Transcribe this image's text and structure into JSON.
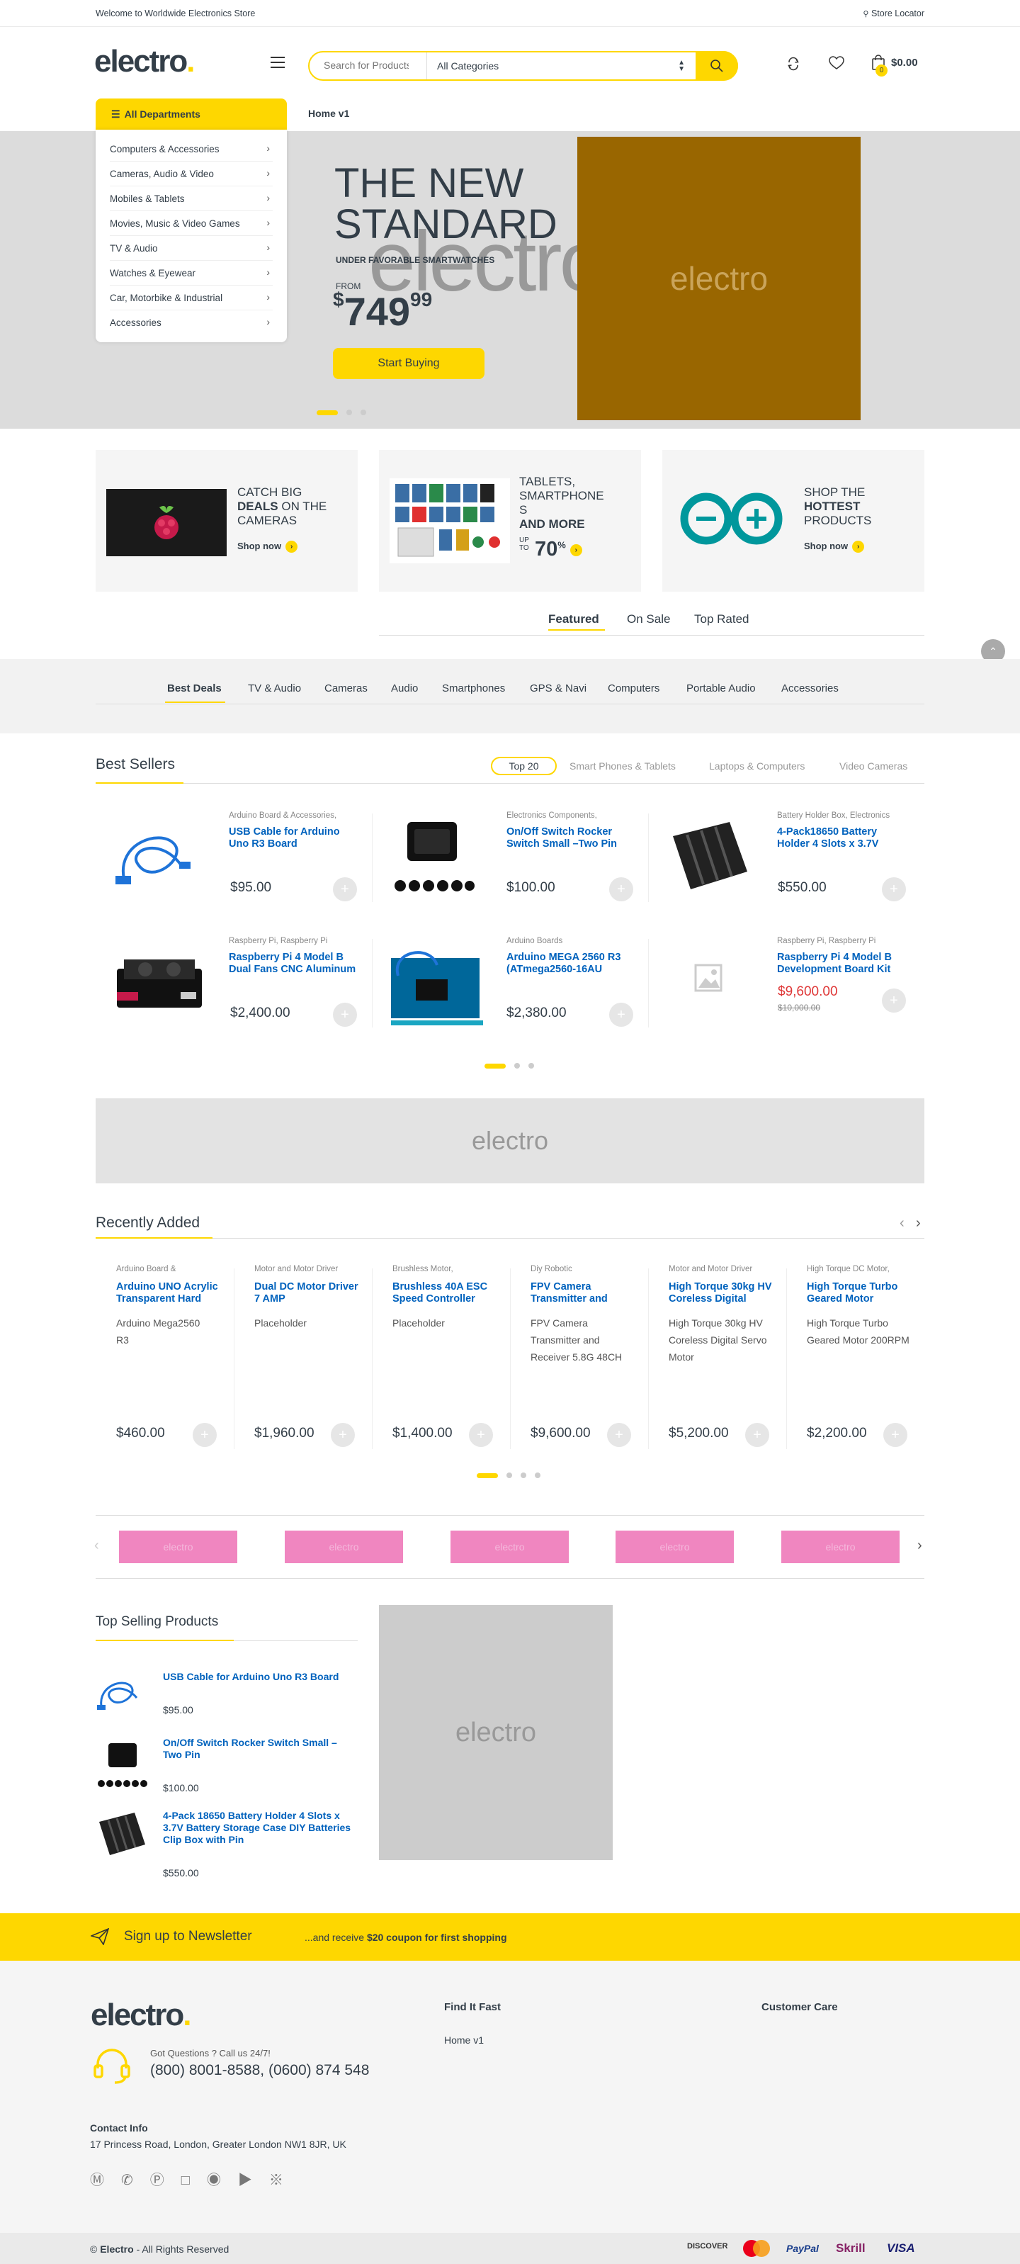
{
  "topbar": {
    "welcome": "Welcome to Worldwide Electronics Store",
    "store_locator": "Store Locator"
  },
  "header": {
    "logo_text": "electro",
    "search_placeholder": "Search for Products",
    "category_select": "All Categories",
    "cart_total": "$0.00",
    "cart_count": "0"
  },
  "departments": {
    "title": "All Departments",
    "items": [
      "Computers & Accessories",
      "Cameras, Audio & Video",
      "Mobiles & Tablets",
      "Movies, Music & Video Games",
      "TV & Audio",
      "Watches & Eyewear",
      "Car, Motorbike & Industrial",
      "Accessories"
    ]
  },
  "nav": {
    "home": "Home v1"
  },
  "hero": {
    "line1": "THE NEW",
    "line2": "STANDARD",
    "sub": "UNDER FAVORABLE SMARTWATCHES",
    "from": "FROM",
    "currency": "$",
    "price_main": "749",
    "price_cents": "99",
    "watermark": "electro",
    "image_text": "electro",
    "button": "Start Buying",
    "colors": {
      "bg": "#dcdcdc",
      "image": "#996600"
    }
  },
  "ads": [
    {
      "l1": "CATCH BIG",
      "bold": "DEALS",
      "l2": " ON THE",
      "l3": "CAMERAS",
      "link": "Shop now"
    },
    {
      "l1": "TABLETS,",
      "l2": "SMARTPHONE",
      "l3": "S",
      "bold": "AND MORE",
      "upto": "UP TO",
      "pct": "70",
      "pct_sign": "%",
      "link": ""
    },
    {
      "l1": "SHOP THE",
      "bold": "HOTTEST",
      "l3": "PRODUCTS",
      "link": "Shop now"
    }
  ],
  "feature_tabs": [
    "Featured",
    "On Sale",
    "Top Rated"
  ],
  "deal_tabs": [
    "Best Deals",
    "TV & Audio",
    "Cameras",
    "Audio",
    "Smartphones",
    "GPS & Navi",
    "Computers",
    "Portable Audio",
    "Accessories"
  ],
  "best_sellers": {
    "title": "Best Sellers",
    "tabs": [
      "Top 20",
      "Smart Phones & Tablets",
      "Laptops & Computers",
      "Video Cameras"
    ],
    "products": [
      {
        "cat": "Arduino Board & Accessories,",
        "name": "USB Cable for Arduino Uno R3 Board",
        "price": "$95.00",
        "old": ""
      },
      {
        "cat": "Electronics Components,",
        "name": "On/Off Switch Rocker Switch Small –Two Pin",
        "price": "$100.00",
        "old": ""
      },
      {
        "cat": "Battery Holder Box, Electronics",
        "name": "4-Pack18650 Battery Holder 4 Slots x 3.7V",
        "price": "$550.00",
        "old": ""
      },
      {
        "cat": "Raspberry Pi, Raspberry Pi",
        "name": "Raspberry Pi 4 Model B Dual Fans CNC Aluminum",
        "price": "$2,400.00",
        "old": ""
      },
      {
        "cat": "Arduino Boards",
        "name": "Arduino MEGA 2560 R3 (ATmega2560-16AU",
        "price": "$2,380.00",
        "old": ""
      },
      {
        "cat": "Raspberry Pi, Raspberry Pi",
        "name": "Raspberry Pi 4 Model B Development Board Kit",
        "price": "$9,600.00",
        "old": "$10,000.00"
      }
    ]
  },
  "banner": {
    "text": "electro"
  },
  "recently_added": {
    "title": "Recently Added",
    "products": [
      {
        "cat": "Arduino Board &",
        "name": "Arduino UNO Acrylic Transparent Hard",
        "img_alt": "Arduino Mega2560 R3",
        "price": "$460.00"
      },
      {
        "cat": "Motor and Motor Driver",
        "name": "Dual DC Motor Driver 7 AMP",
        "img_alt": "Placeholder",
        "price": "$1,960.00"
      },
      {
        "cat": "Brushless Motor,",
        "name": "Brushless 40A ESC Speed Controller",
        "img_alt": "Placeholder",
        "price": "$1,400.00"
      },
      {
        "cat": "Diy Robotic",
        "name": "FPV Camera Transmitter and",
        "img_alt": "FPV Camera Transmitter and Receiver 5.8G 48CH",
        "price": "$9,600.00"
      },
      {
        "cat": "Motor and Motor Driver",
        "name": "High Torque 30kg HV Coreless Digital",
        "img_alt": "High Torque 30kg HV Coreless Digital Servo Motor",
        "price": "$5,200.00"
      },
      {
        "cat": "High Torque DC Motor,",
        "name": "High Torque Turbo Geared Motor",
        "img_alt": "High Torque Turbo Geared Motor 200RPM",
        "price": "$2,200.00"
      }
    ]
  },
  "brands": [
    "electro",
    "electro",
    "electro",
    "electro",
    "electro"
  ],
  "top_selling": {
    "title": "Top Selling Products",
    "products": [
      {
        "name": "USB Cable for Arduino Uno R3 Board",
        "price": "$95.00"
      },
      {
        "name": "On/Off Switch Rocker Switch Small –Two Pin",
        "price": "$100.00"
      },
      {
        "name": "4-Pack 18650 Battery Holder 4 Slots x 3.7V Battery Storage Case DIY Batteries Clip Box with Pin",
        "price": "$550.00"
      }
    ],
    "side_image_text": "electro"
  },
  "newsletter": {
    "title": "Sign up to Newsletter",
    "pre": "...and receive ",
    "bold": "$20 coupon for first shopping"
  },
  "footer": {
    "logo_text": "electro",
    "questions": "Got Questions ? Call us 24/7!",
    "phones": "(800) 8001-8588, (0600) 874 548",
    "contact_title": "Contact Info",
    "address": "17 Princess Road, London, Greater London NW1 8JR, UK",
    "find_title": "Find It Fast",
    "find_links": [
      "Home v1"
    ],
    "care_title": "Customer Care",
    "social_icons": [
      "facebook-icon",
      "whatsapp-icon",
      "pinterest-icon",
      "linkedin-icon",
      "instagram-icon",
      "youtube-icon",
      "rss-icon"
    ]
  },
  "copyright": {
    "sym": "© ",
    "brand": "Electro",
    "rest": " - All Rights Reserved"
  },
  "payments": [
    "DISCOVER",
    "mastercard",
    "PayPal",
    "Skrill",
    "VISA"
  ],
  "colors": {
    "accent": "#fed700",
    "link": "#0062bd",
    "sale": "#df3737",
    "text": "#333e48"
  }
}
